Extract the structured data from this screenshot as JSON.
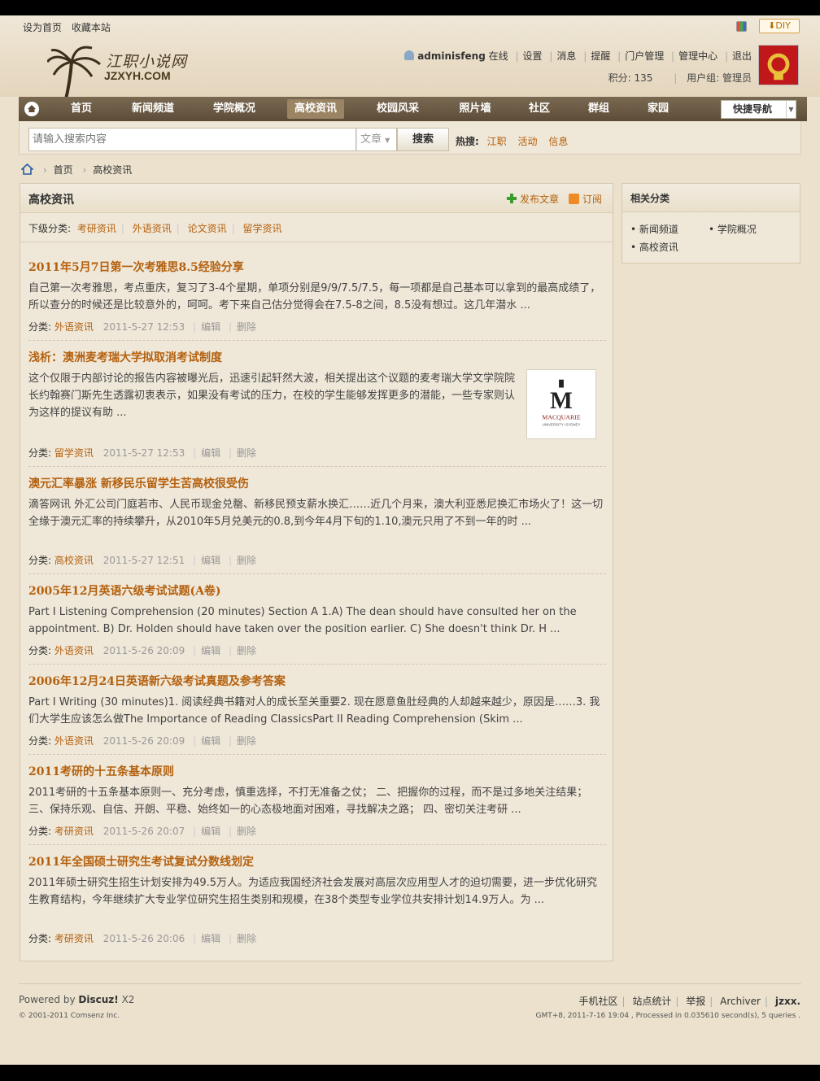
{
  "top_links": [
    "设为首页",
    "收藏本站"
  ],
  "diy_label": "DIY",
  "logo": {
    "text": "江职小说网",
    "sub": "JZXYH.COM"
  },
  "user": {
    "name": "adminisfeng",
    "status": "在线",
    "links": [
      "设置",
      "消息",
      "提醒",
      "门户管理",
      "管理中心",
      "退出"
    ],
    "points": "积分: 135",
    "group": "用户组: 管理员"
  },
  "nav": {
    "items": [
      "首页",
      "新闻频道",
      "学院概况",
      "高校资讯",
      "校园风采",
      "照片墙",
      "社区",
      "群组",
      "家园"
    ],
    "active": "高校资讯",
    "quick_nav": "快捷导航"
  },
  "search": {
    "placeholder": "请输入搜索内容",
    "type": "文章",
    "button": "搜索",
    "hot_label": "热搜:",
    "hot_items": [
      "江职",
      "活动",
      "信息"
    ]
  },
  "breadcrumb": [
    "首页",
    "高校资讯"
  ],
  "main": {
    "title": "高校资讯",
    "post_label": "发布文章",
    "rss_label": "订阅",
    "subcat_label": "下级分类:",
    "subcats": [
      "考研资讯",
      "外语资讯",
      "论文资讯",
      "留学资讯"
    ],
    "meta_label": "分类:",
    "edit_label": "编辑",
    "delete_label": "删除",
    "articles": [
      {
        "title": "2011年5月7日第一次考雅思8.5经验分享",
        "summary": "自己第一次考雅思，考点重庆，复习了3-4个星期，单项分别是9/9/7.5/7.5，每一项都是自己基本可以拿到的最高成绩了，所以查分的时候还是比较意外的，呵呵。考下来自己估分觉得会在7.5-8之间，8.5没有想过。这几年潜水 ...",
        "category": "外语资讯",
        "date": "2011-5-27 12:53"
      },
      {
        "title": "浅析：澳洲麦考瑞大学拟取消考试制度",
        "summary": "这个仅限于内部讨论的报告内容被曝光后，迅速引起轩然大波，相关提出这个议题的麦考瑞大学文学院院长约翰赛门斯先生透露初衷表示，如果没有考试的压力，在校的学生能够发挥更多的潜能，一些专家则认为这样的提议有助 ...",
        "category": "留学资讯",
        "date": "2011-5-27 12:53",
        "thumb_name": "MACQUARIE",
        "thumb_sub": "UNIVERSITY~SYDNEY"
      },
      {
        "title": "澳元汇率暴涨 新移民乐留学生苦高校很受伤",
        "summary": "滴答网讯 外汇公司门庭若市、人民币现金兑罄、新移民预支薪水换汇……近几个月来，澳大利亚悉尼换汇市场火了！这一切全缘于澳元汇率的持续攀升，从2010年5月兑美元的0.8,到今年4月下旬的1.10,澳元只用了不到一年的时 ...",
        "category": "高校资讯",
        "date": "2011-5-27 12:51"
      },
      {
        "title": "2005年12月英语六级考试试题(A卷)",
        "summary": "Part I Listening Comprehension (20 minutes) Section A 1.A) The dean should have consulted her on the appointment. B) Dr. Holden should have taken over the position earlier. C) She doesn't think Dr. H ...",
        "category": "外语资讯",
        "date": "2011-5-26 20:09"
      },
      {
        "title": "2006年12月24日英语新六级考试真题及参考答案",
        "summary": "Part I Writing (30 minutes)1.  阅读经典书籍对人的成长至关重要2.  现在愿意鱼肚经典的人却越来越少，原因是……3.  我们大学生应该怎么做The Importance of Reading ClassicsPart II Reading Comprehension (Skim ...",
        "category": "外语资讯",
        "date": "2011-5-26 20:09"
      },
      {
        "title": "2011考研的十五条基本原则",
        "summary": "2011考研的十五条基本原则一、充分考虑，慎重选择，不打无准备之仗； 二、把握你的过程，而不是过多地关注结果； 三、保持乐观、自信、开朗、平稳、始终如一的心态极地面对困难，寻找解决之路； 四、密切关注考研 ...",
        "category": "考研资讯",
        "date": "2011-5-26 20:07"
      },
      {
        "title": "2011年全国硕士研究生考试复试分数线划定",
        "summary": "2011年硕士研究生招生计划安排为49.5万人。为适应我国经济社会发展对高层次应用型人才的迫切需要，进一步优化研究生教育结构，今年继续扩大专业学位研究生招生类别和规模，在38个类型专业学位共安排计划14.9万人。为 ...",
        "category": "考研资讯",
        "date": "2011-5-26 20:06"
      }
    ]
  },
  "sidebar": {
    "title": "相关分类",
    "items": [
      "新闻频道",
      "学院概况",
      "高校资讯"
    ]
  },
  "footer": {
    "powered_prefix": "Powered by",
    "powered_name": "Discuz!",
    "powered_ver": "X2",
    "copyright": "© 2001-2011 Comsenz Inc.",
    "links": [
      "手机社区",
      "站点统计",
      "举报",
      "Archiver",
      "jzxx."
    ],
    "stats": "GMT+8, 2011-7-16 19:04 , Processed in 0.035610 second(s), 5 queries ."
  },
  "colors": {
    "accent": "#b4610f",
    "nav_bg": "#6b5a43",
    "page_bg": "#ebe1cd"
  }
}
